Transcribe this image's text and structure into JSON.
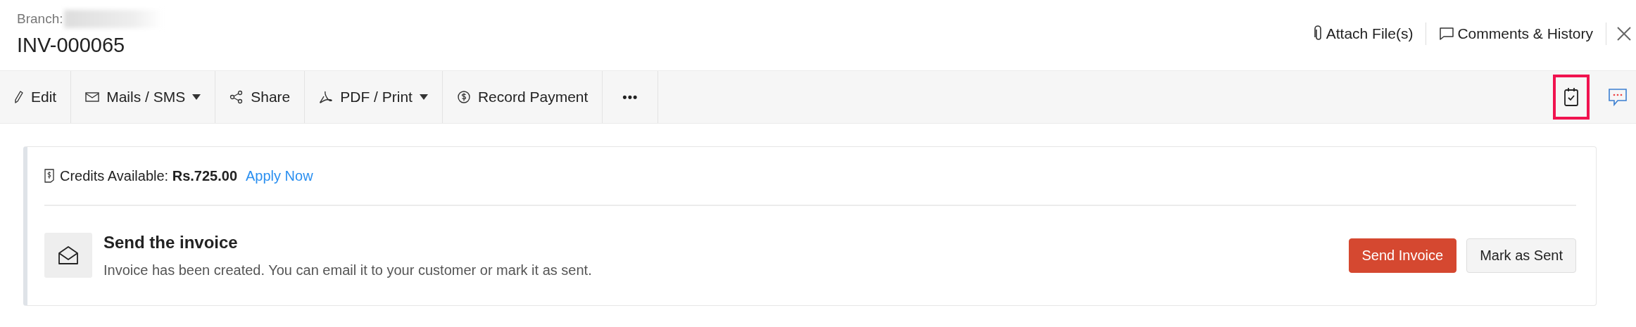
{
  "header": {
    "branch_label": "Branch:",
    "title": "INV-000065",
    "actions": [
      {
        "kind": "attach",
        "label": "Attach File(s)"
      },
      {
        "kind": "comments",
        "label": "Comments & History"
      }
    ]
  },
  "toolbar": {
    "items": [
      {
        "kind": "edit",
        "label": "Edit",
        "dropdown": false
      },
      {
        "kind": "mail",
        "label": "Mails / SMS",
        "dropdown": true
      },
      {
        "kind": "share",
        "label": "Share",
        "dropdown": false
      },
      {
        "kind": "pdf",
        "label": "PDF / Print",
        "dropdown": true
      },
      {
        "kind": "payment",
        "label": "Record Payment",
        "dropdown": false
      },
      {
        "kind": "more",
        "label": "•••",
        "dropdown": false
      }
    ],
    "right_icons": [
      {
        "kind": "checklist",
        "highlighted": true
      },
      {
        "kind": "chat",
        "highlighted": false
      }
    ]
  },
  "credits": {
    "label": "Credits Available:",
    "amount": "Rs.725.00",
    "link": "Apply Now"
  },
  "send_panel": {
    "title": "Send the invoice",
    "description": "Invoice has been created. You can email it to your customer or mark it as sent.",
    "buttons": [
      {
        "label": "Send Invoice",
        "primary": true
      },
      {
        "label": "Mark as Sent",
        "primary": false
      }
    ]
  }
}
